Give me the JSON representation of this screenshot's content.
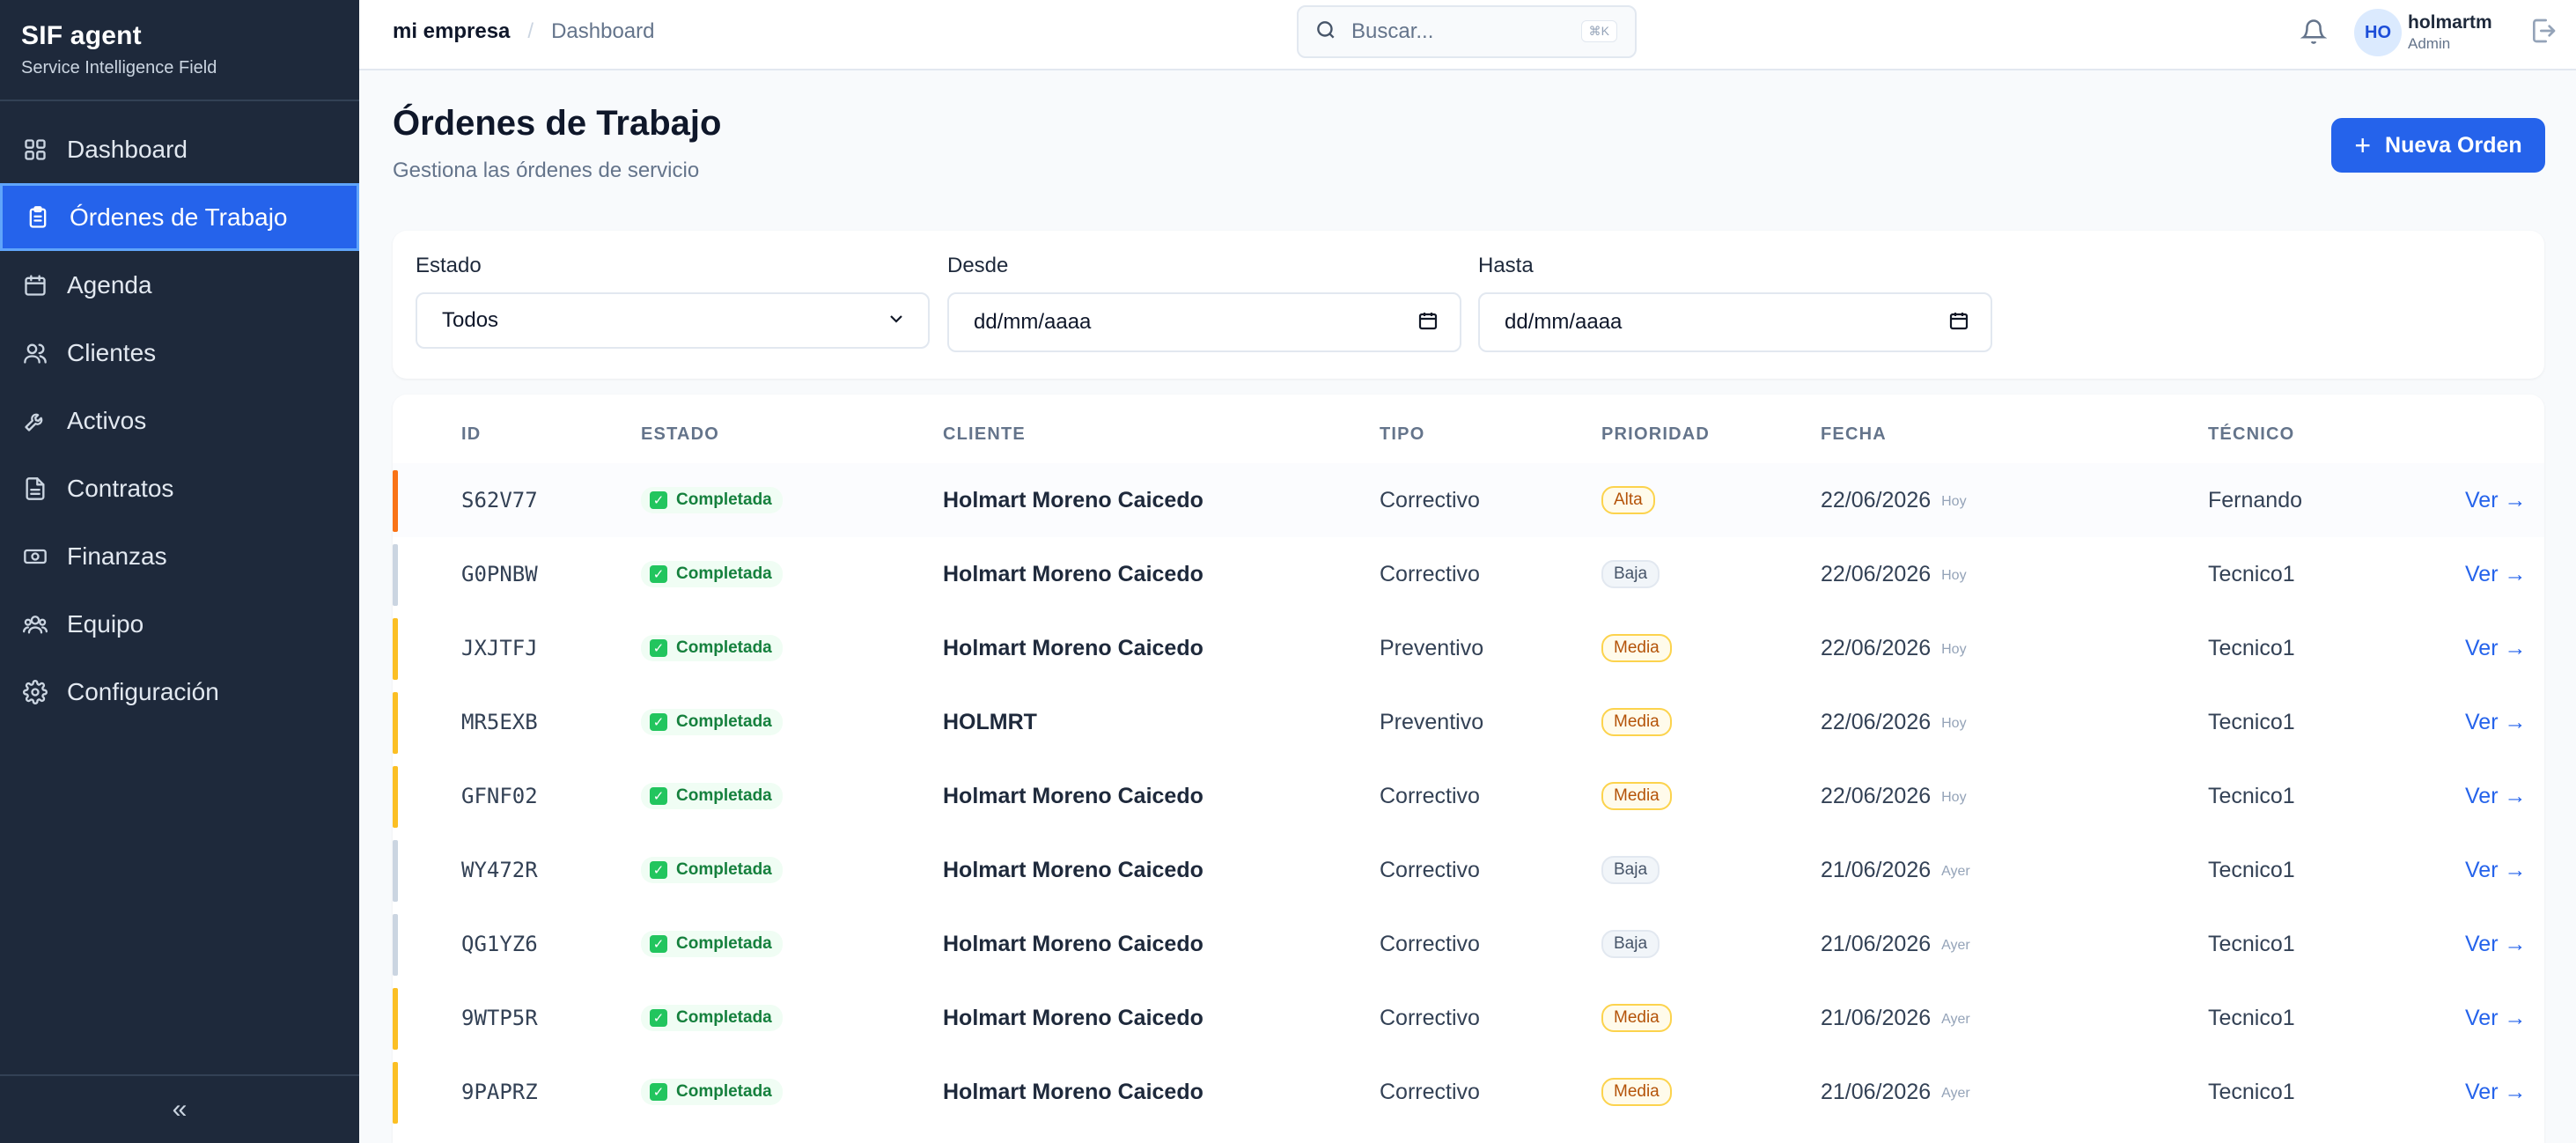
{
  "sidebar": {
    "brand": "SIF agent",
    "tagline": "Service Intelligence Field",
    "items": [
      {
        "label": "Dashboard",
        "icon": "grid-icon"
      },
      {
        "label": "Órdenes de Trabajo",
        "icon": "clipboard-icon",
        "active": true
      },
      {
        "label": "Agenda",
        "icon": "calendar-icon"
      },
      {
        "label": "Clientes",
        "icon": "users-icon"
      },
      {
        "label": "Activos",
        "icon": "wrench-icon"
      },
      {
        "label": "Contratos",
        "icon": "file-icon"
      },
      {
        "label": "Finanzas",
        "icon": "banknote-icon"
      },
      {
        "label": "Equipo",
        "icon": "team-icon"
      },
      {
        "label": "Configuración",
        "icon": "gear-icon"
      }
    ],
    "collapse_label": "«"
  },
  "topbar": {
    "breadcrumb": [
      "mi empresa",
      "Dashboard"
    ],
    "separator": "/",
    "search_placeholder": "Buscar...",
    "search_shortcut": "⌘K",
    "user_initials": "HO",
    "user_name": "holmartm",
    "user_role": "Admin"
  },
  "page": {
    "title": "Órdenes de Trabajo",
    "subtitle": "Gestiona las órdenes de servicio",
    "new_button": "Nueva Orden",
    "new_button_icon": "+"
  },
  "filters": {
    "estado_label": "Estado",
    "estado_value": "Todos",
    "desde_label": "Desde",
    "desde_value": "dd/mm/aaaa",
    "hasta_label": "Hasta",
    "hasta_value": "dd/mm/aaaa"
  },
  "table": {
    "headers": [
      "ID",
      "ESTADO",
      "CLIENTE",
      "TIPO",
      "PRIORIDAD",
      "FECHA",
      "TÉCNICO"
    ],
    "action_label": "Ver →",
    "status_check": "✓",
    "rows": [
      {
        "id": "S62V77",
        "estado": "Completada",
        "cliente": "Holmart Moreno Caicedo",
        "tipo": "Correctivo",
        "prioridad": "Alta",
        "fecha": "22/06/2026",
        "rel": "Hoy",
        "tecnico": "Fernando",
        "accent": "#f97316"
      },
      {
        "id": "G0PNBW",
        "estado": "Completada",
        "cliente": "Holmart Moreno Caicedo",
        "tipo": "Correctivo",
        "prioridad": "Baja",
        "fecha": "22/06/2026",
        "rel": "Hoy",
        "tecnico": "Tecnico1",
        "accent": "#cbd5e1"
      },
      {
        "id": "JXJTFJ",
        "estado": "Completada",
        "cliente": "Holmart Moreno Caicedo",
        "tipo": "Preventivo",
        "prioridad": "Media",
        "fecha": "22/06/2026",
        "rel": "Hoy",
        "tecnico": "Tecnico1",
        "accent": "#fbbf24"
      },
      {
        "id": "MR5EXB",
        "estado": "Completada",
        "cliente": "HOLMRT",
        "tipo": "Preventivo",
        "prioridad": "Media",
        "fecha": "22/06/2026",
        "rel": "Hoy",
        "tecnico": "Tecnico1",
        "accent": "#fbbf24"
      },
      {
        "id": "GFNF02",
        "estado": "Completada",
        "cliente": "Holmart Moreno Caicedo",
        "tipo": "Correctivo",
        "prioridad": "Media",
        "fecha": "22/06/2026",
        "rel": "Hoy",
        "tecnico": "Tecnico1",
        "accent": "#fbbf24"
      },
      {
        "id": "WY472R",
        "estado": "Completada",
        "cliente": "Holmart Moreno Caicedo",
        "tipo": "Correctivo",
        "prioridad": "Baja",
        "fecha": "21/06/2026",
        "rel": "Ayer",
        "tecnico": "Tecnico1",
        "accent": "#cbd5e1"
      },
      {
        "id": "QG1YZ6",
        "estado": "Completada",
        "cliente": "Holmart Moreno Caicedo",
        "tipo": "Correctivo",
        "prioridad": "Baja",
        "fecha": "21/06/2026",
        "rel": "Ayer",
        "tecnico": "Tecnico1",
        "accent": "#cbd5e1"
      },
      {
        "id": "9WTP5R",
        "estado": "Completada",
        "cliente": "Holmart Moreno Caicedo",
        "tipo": "Correctivo",
        "prioridad": "Media",
        "fecha": "21/06/2026",
        "rel": "Ayer",
        "tecnico": "Tecnico1",
        "accent": "#fbbf24"
      },
      {
        "id": "9PAPRZ",
        "estado": "Completada",
        "cliente": "Holmart Moreno Caicedo",
        "tipo": "Correctivo",
        "prioridad": "Media",
        "fecha": "21/06/2026",
        "rel": "Ayer",
        "tecnico": "Tecnico1",
        "accent": "#fbbf24"
      }
    ]
  },
  "colors": {
    "sidebar_bg": "#1e293b",
    "accent_blue": "#2563eb",
    "success_green": "#22c55e",
    "priority_alta": "#f97316",
    "priority_media": "#fbbf24",
    "priority_baja": "#cbd5e1"
  }
}
